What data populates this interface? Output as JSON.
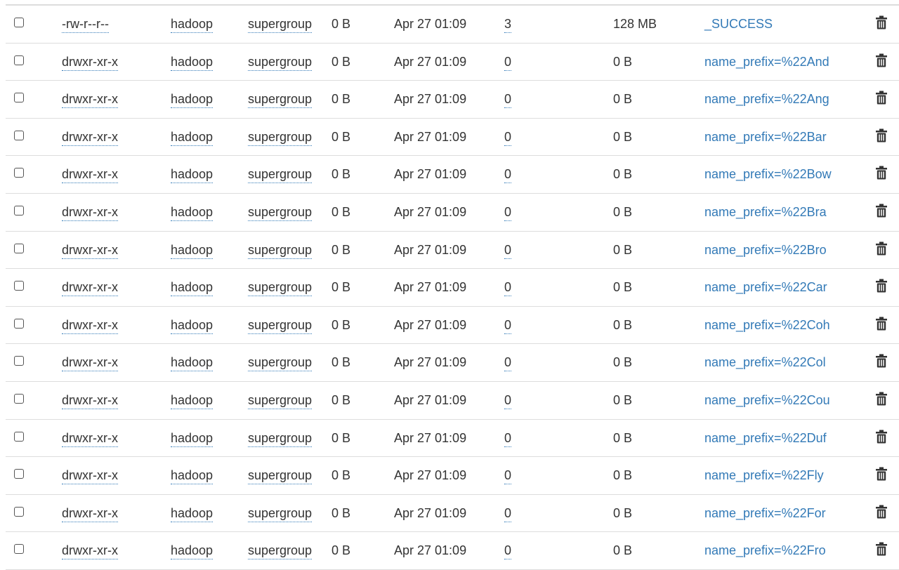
{
  "table": {
    "rows": [
      {
        "permission": "-rw-r--r--",
        "owner": "hadoop",
        "group": "supergroup",
        "size": "0 B",
        "last_modified": "Apr 27 01:09",
        "replication": "3",
        "block_size": "128 MB",
        "name": "_SUCCESS"
      },
      {
        "permission": "drwxr-xr-x",
        "owner": "hadoop",
        "group": "supergroup",
        "size": "0 B",
        "last_modified": "Apr 27 01:09",
        "replication": "0",
        "block_size": "0 B",
        "name": "name_prefix=%22And"
      },
      {
        "permission": "drwxr-xr-x",
        "owner": "hadoop",
        "group": "supergroup",
        "size": "0 B",
        "last_modified": "Apr 27 01:09",
        "replication": "0",
        "block_size": "0 B",
        "name": "name_prefix=%22Ang"
      },
      {
        "permission": "drwxr-xr-x",
        "owner": "hadoop",
        "group": "supergroup",
        "size": "0 B",
        "last_modified": "Apr 27 01:09",
        "replication": "0",
        "block_size": "0 B",
        "name": "name_prefix=%22Bar"
      },
      {
        "permission": "drwxr-xr-x",
        "owner": "hadoop",
        "group": "supergroup",
        "size": "0 B",
        "last_modified": "Apr 27 01:09",
        "replication": "0",
        "block_size": "0 B",
        "name": "name_prefix=%22Bow"
      },
      {
        "permission": "drwxr-xr-x",
        "owner": "hadoop",
        "group": "supergroup",
        "size": "0 B",
        "last_modified": "Apr 27 01:09",
        "replication": "0",
        "block_size": "0 B",
        "name": "name_prefix=%22Bra"
      },
      {
        "permission": "drwxr-xr-x",
        "owner": "hadoop",
        "group": "supergroup",
        "size": "0 B",
        "last_modified": "Apr 27 01:09",
        "replication": "0",
        "block_size": "0 B",
        "name": "name_prefix=%22Bro"
      },
      {
        "permission": "drwxr-xr-x",
        "owner": "hadoop",
        "group": "supergroup",
        "size": "0 B",
        "last_modified": "Apr 27 01:09",
        "replication": "0",
        "block_size": "0 B",
        "name": "name_prefix=%22Car"
      },
      {
        "permission": "drwxr-xr-x",
        "owner": "hadoop",
        "group": "supergroup",
        "size": "0 B",
        "last_modified": "Apr 27 01:09",
        "replication": "0",
        "block_size": "0 B",
        "name": "name_prefix=%22Coh"
      },
      {
        "permission": "drwxr-xr-x",
        "owner": "hadoop",
        "group": "supergroup",
        "size": "0 B",
        "last_modified": "Apr 27 01:09",
        "replication": "0",
        "block_size": "0 B",
        "name": "name_prefix=%22Col"
      },
      {
        "permission": "drwxr-xr-x",
        "owner": "hadoop",
        "group": "supergroup",
        "size": "0 B",
        "last_modified": "Apr 27 01:09",
        "replication": "0",
        "block_size": "0 B",
        "name": "name_prefix=%22Cou"
      },
      {
        "permission": "drwxr-xr-x",
        "owner": "hadoop",
        "group": "supergroup",
        "size": "0 B",
        "last_modified": "Apr 27 01:09",
        "replication": "0",
        "block_size": "0 B",
        "name": "name_prefix=%22Duf"
      },
      {
        "permission": "drwxr-xr-x",
        "owner": "hadoop",
        "group": "supergroup",
        "size": "0 B",
        "last_modified": "Apr 27 01:09",
        "replication": "0",
        "block_size": "0 B",
        "name": "name_prefix=%22Fly"
      },
      {
        "permission": "drwxr-xr-x",
        "owner": "hadoop",
        "group": "supergroup",
        "size": "0 B",
        "last_modified": "Apr 27 01:09",
        "replication": "0",
        "block_size": "0 B",
        "name": "name_prefix=%22For"
      },
      {
        "permission": "drwxr-xr-x",
        "owner": "hadoop",
        "group": "supergroup",
        "size": "0 B",
        "last_modified": "Apr 27 01:09",
        "replication": "0",
        "block_size": "0 B",
        "name": "name_prefix=%22Fro"
      }
    ]
  },
  "icons": {
    "row_select": "checkbox",
    "row_delete": "trash-icon"
  },
  "colors": {
    "link": "#337ab7",
    "text": "#333333",
    "border": "#dddddd",
    "trash": "#333333"
  }
}
